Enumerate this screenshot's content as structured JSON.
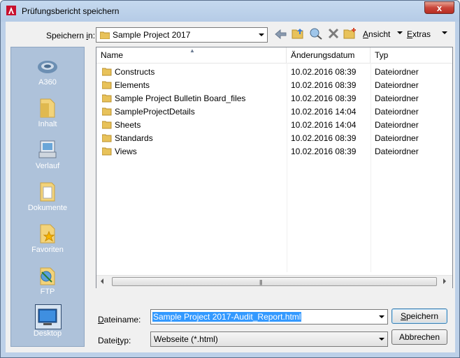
{
  "window": {
    "title": "Prüfungsbericht speichern",
    "close_glyph": "x"
  },
  "toolbar": {
    "save_in_label_pre": "Speichern ",
    "save_in_label_u": "i",
    "save_in_label_post": "n:",
    "location": "Sample Project 2017",
    "view_u": "A",
    "view_rest": "nsicht",
    "extras_u": "E",
    "extras_rest": "xtras"
  },
  "places": [
    {
      "label": "A360",
      "icon": "cloud-icon"
    },
    {
      "label": "Inhalt",
      "icon": "folder-icon"
    },
    {
      "label": "Verlauf",
      "icon": "history-icon"
    },
    {
      "label": "Dokumente",
      "icon": "documents-icon"
    },
    {
      "label": "Favoriten",
      "icon": "favorites-icon"
    },
    {
      "label": "FTP",
      "icon": "ftp-icon"
    },
    {
      "label": "Desktop",
      "icon": "desktop-icon"
    }
  ],
  "columns": {
    "name": "Name",
    "date": "Änderungsdatum",
    "type": "Typ"
  },
  "files": [
    {
      "name": "Constructs",
      "date": "10.02.2016 08:39",
      "type": "Dateiordner"
    },
    {
      "name": "Elements",
      "date": "10.02.2016 08:39",
      "type": "Dateiordner"
    },
    {
      "name": "Sample Project Bulletin Board_files",
      "date": "10.02.2016 08:39",
      "type": "Dateiordner"
    },
    {
      "name": "SampleProjectDetails",
      "date": "10.02.2016 14:04",
      "type": "Dateiordner"
    },
    {
      "name": "Sheets",
      "date": "10.02.2016 14:04",
      "type": "Dateiordner"
    },
    {
      "name": "Standards",
      "date": "10.02.2016 08:39",
      "type": "Dateiordner"
    },
    {
      "name": "Views",
      "date": "10.02.2016 08:39",
      "type": "Dateiordner"
    }
  ],
  "form": {
    "filename_label_u": "D",
    "filename_label_rest": "ateiname:",
    "filename_value": "Sample Project 2017-Audit_Report.html",
    "filetype_label_pre": "Datei",
    "filetype_label_u": "t",
    "filetype_label_post": "yp:",
    "filetype_value": "Webseite (*.html)",
    "save_u": "S",
    "save_rest": "peichern",
    "cancel_label": "Abbrechen"
  },
  "colors": {
    "accent": "#3399ff",
    "places_bg": "#aec2da",
    "folder": "#e8c25a"
  }
}
